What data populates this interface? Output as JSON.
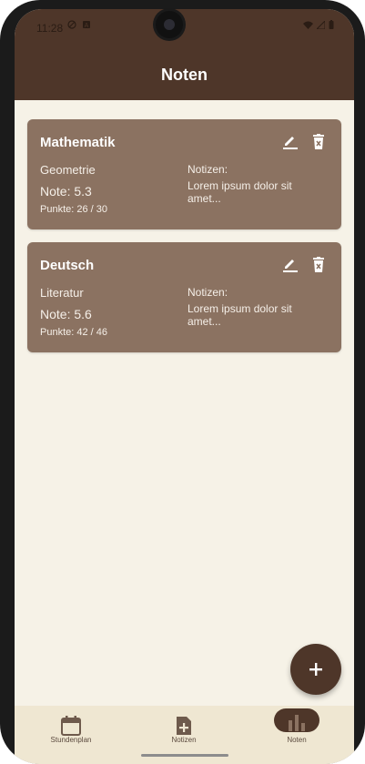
{
  "status": {
    "time": "11:28"
  },
  "header": {
    "title": "Noten"
  },
  "cards": [
    {
      "subject": "Mathematik",
      "topic": "Geometrie",
      "grade": "Note: 5.3",
      "points": "Punkte: 26 / 30",
      "notes_label": "Notizen:",
      "notes_text": "Lorem ipsum dolor sit amet..."
    },
    {
      "subject": "Deutsch",
      "topic": "Literatur",
      "grade": "Note: 5.6",
      "points": "Punkte: 42 / 46",
      "notes_label": "Notizen:",
      "notes_text": "Lorem ipsum dolor sit amet..."
    }
  ],
  "fab": {
    "icon": "plus-icon"
  },
  "bottom_nav": {
    "items": [
      {
        "label": "Stundenplan",
        "icon": "calendar-icon",
        "active": false
      },
      {
        "label": "Notizen",
        "icon": "note-add-icon",
        "active": false
      },
      {
        "label": "Noten",
        "icon": "bar-chart-icon",
        "active": true
      }
    ]
  },
  "colors": {
    "primary": "#4e3629",
    "card": "#8b7261",
    "background": "#f6f2e7",
    "nav_background": "#efe7d2"
  }
}
